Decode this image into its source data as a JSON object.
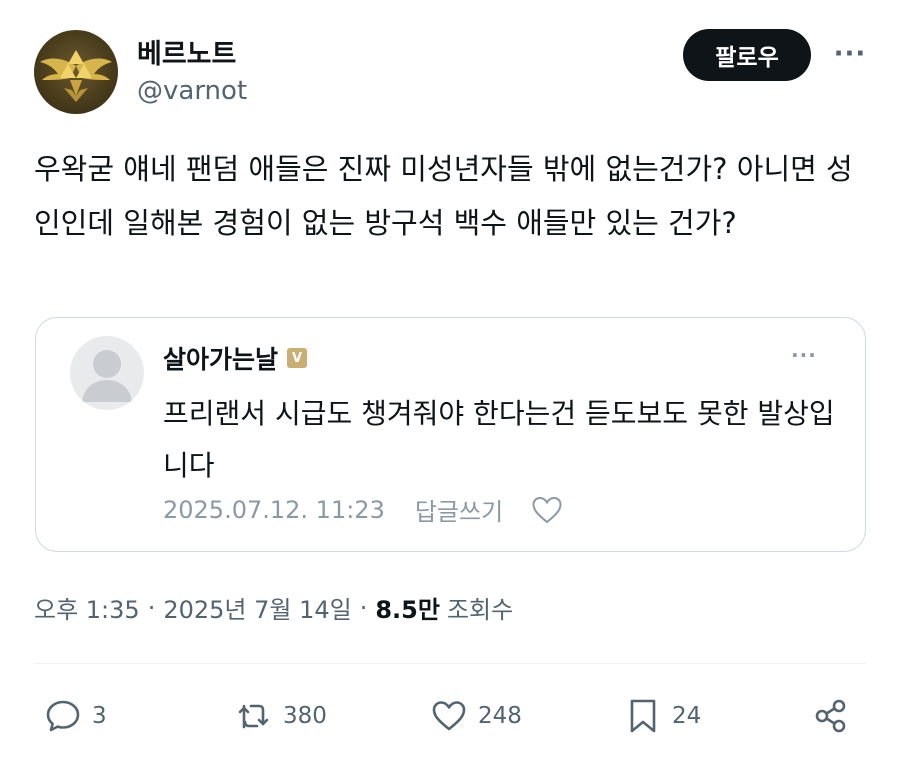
{
  "post": {
    "display_name": "베르노트",
    "handle": "@varnot",
    "follow_label": "팔로우",
    "more_label": "···",
    "text": "우왁굳 얘네 팬덤 애들은 진짜 미성년자들 밖에 없는건가? 아니면 성인인데 일해본 경험이 없는 방구석 백수 애들만 있는 건가?"
  },
  "quote": {
    "author": "살아가는날",
    "badge": "V",
    "more_label": "···",
    "text": "프리랜서 시급도 챙겨줘야 한다는건 듣도보도 못한 발상입니다",
    "date": "2025.07.12. 11:23",
    "reply_label": "답글쓰기",
    "heart_icon": "heart-outline-icon"
  },
  "meta": {
    "time": "오후 1:35",
    "separator": "·",
    "date": "2025년 7월 14일",
    "views_count": "8.5만",
    "views_label": "조회수"
  },
  "actions": {
    "replies": "3",
    "reposts": "380",
    "likes": "248",
    "bookmarks": "24"
  },
  "icons": {
    "reply": "speech-bubble-icon",
    "repost": "repost-arrows-icon",
    "like": "heart-icon",
    "bookmark": "bookmark-icon",
    "share": "share-nodes-icon"
  },
  "colors": {
    "text": "#0f1419",
    "muted": "#536471",
    "border": "#cfd9de",
    "follow_bg": "#0f1419",
    "badge": "#c9b072"
  }
}
